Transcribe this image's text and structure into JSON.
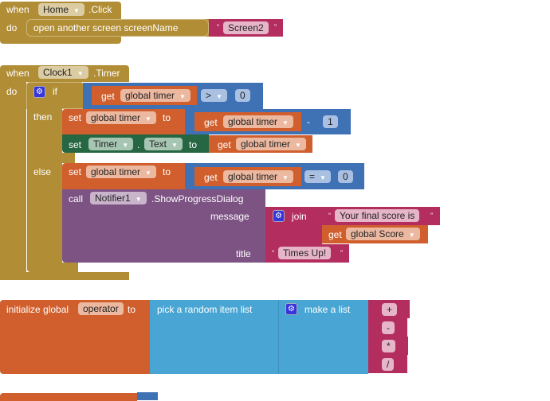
{
  "colors": {
    "event": "#B18E35",
    "text": "#B32D5E",
    "variable": "#D05F2D",
    "math": "#3F71B5",
    "component": "#266643",
    "procedure_call": "#7D5384",
    "lists": "#49A6D4"
  },
  "block1": {
    "when": "when",
    "component": "Home",
    "event": ".Click",
    "do": "do",
    "statement": "open another screen  screenName",
    "value": "Screen2"
  },
  "block2": {
    "when": "when",
    "component": "Clock1",
    "event": ".Timer",
    "do": "do",
    "if": "if",
    "then": "then",
    "else": "else",
    "cond": {
      "get": "get",
      "var": "global timer",
      "op": ">",
      "num": "0"
    },
    "then_set": {
      "set": "set",
      "var": "global timer",
      "to": "to",
      "get": "get",
      "getvar": "global timer",
      "op": "-",
      "num": "1"
    },
    "then_set2": {
      "set": "set",
      "component": "Timer",
      "dot": ".",
      "prop": "Text",
      "to": "to",
      "get": "get",
      "getvar": "global timer"
    },
    "else_set": {
      "set": "set",
      "var": "global timer",
      "to": "to",
      "get": "get",
      "getvar": "global timer",
      "op": "=",
      "num": "0"
    },
    "call": {
      "call": "call",
      "component": "Notifier1",
      "method": ".ShowProgressDialog",
      "message": "message",
      "join": "join",
      "text1": "Your final score is",
      "get": "get",
      "getvar": "global Score",
      "title": "title",
      "title_value": "Times Up!"
    }
  },
  "block3": {
    "init": "initialize global",
    "name": "operator",
    "to": "to",
    "pick": "pick a random item  list",
    "make": "make a list",
    "items": [
      "+",
      "-",
      "*",
      "/"
    ]
  },
  "icons": {
    "gear": "gear-icon",
    "dropdown": "dropdown-arrow-icon"
  }
}
